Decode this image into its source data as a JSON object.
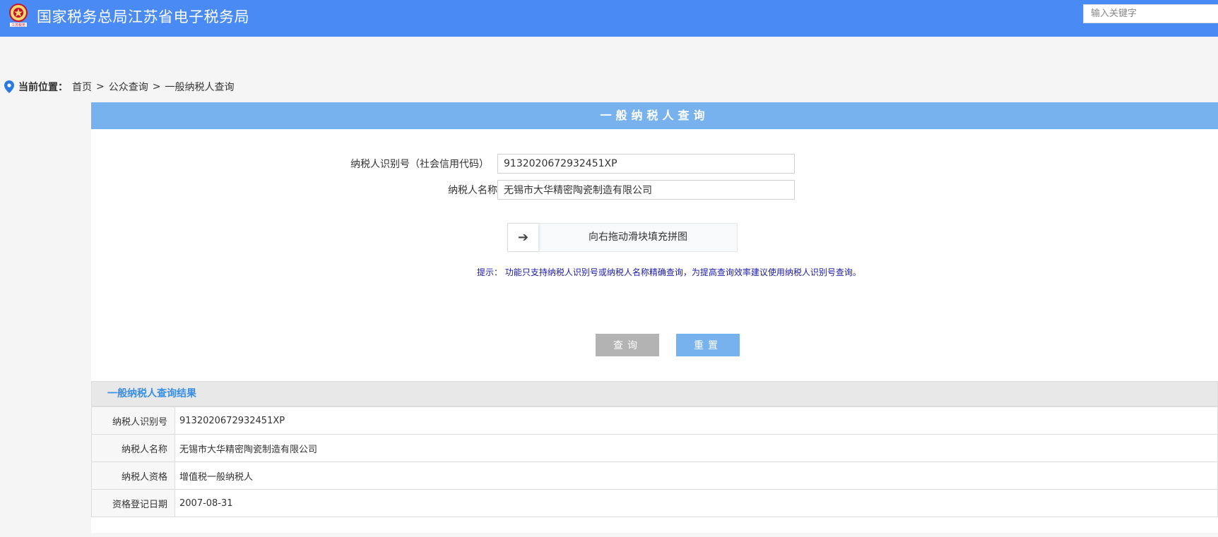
{
  "header": {
    "title": "国家税务总局江苏省电子税务局",
    "logo_caption": "江苏税务",
    "search_placeholder": "输入关键字"
  },
  "breadcrumb": {
    "label": "当前位置：",
    "items": [
      "首页",
      "公众查询",
      "一般纳税人查询"
    ],
    "separator": ">"
  },
  "form": {
    "title": "一般纳税人查询",
    "taxpayer_id_label": "纳税人识别号（社会信用代码）",
    "taxpayer_id_value": "9132020672932451XP",
    "taxpayer_name_label": "纳税人名称",
    "taxpayer_name_value": "无锡市大华精密陶瓷制造有限公司",
    "slider_arrow": "➔",
    "slider_text": "向右拖动滑块填充拼图",
    "hint": "提示： 功能只支持纳税人识别号或纳税人名称精确查询，为提高查询效率建议使用纳税人识别号查询。",
    "query_button": "查询",
    "reset_button": "重置"
  },
  "result": {
    "title": "一般纳税人查询结果",
    "rows": [
      {
        "label": "纳税人识别号",
        "value": "9132020672932451XP"
      },
      {
        "label": "纳税人名称",
        "value": "无锡市大华精密陶瓷制造有限公司"
      },
      {
        "label": "纳税人资格",
        "value": "增值税一般纳税人"
      },
      {
        "label": "资格登记日期",
        "value": "2007-08-31"
      }
    ]
  },
  "colors": {
    "header_bg": "#4a8af4",
    "panel_head_bg": "#78b2ee",
    "hint_text": "#1a1aa6",
    "result_title": "#3a8ee6"
  },
  "icons": [
    "tax-emblem-icon",
    "location-pin-icon",
    "arrow-right-icon"
  ]
}
